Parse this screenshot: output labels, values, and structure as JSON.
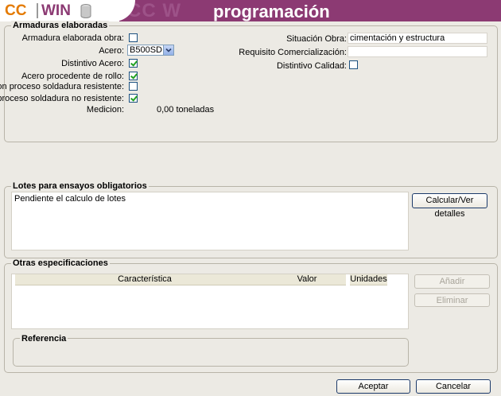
{
  "header": {
    "logo_cc": "CC",
    "logo_win": "WIN",
    "ghost_text": "CC W",
    "title": "programación"
  },
  "armaduras": {
    "title": "Armaduras elaboradas",
    "fields": {
      "armadura_elaborada_obra": {
        "label": "Armadura elaborada obra:",
        "checked": false
      },
      "acero": {
        "label": "Acero:",
        "value": "B500SD"
      },
      "distintivo_acero": {
        "label": "Distintivo Acero:",
        "checked": true
      },
      "acero_rollo": {
        "label": "Acero procedente de rollo:",
        "checked": true
      },
      "soldadura_resistente": {
        "label": "Con proceso soldadura resistente:",
        "checked": false
      },
      "soldadura_no_resistente": {
        "label": "Con proceso soldadura no resistente:",
        "checked": true
      },
      "medicion": {
        "label": "Medicion:",
        "value": "0,00 toneladas"
      },
      "situacion_obra": {
        "label": "Situación Obra:",
        "value": "cimentación y estructura"
      },
      "requisito_comercializacion": {
        "label": "Requisito Comercialización:",
        "value": ""
      },
      "distintivo_calidad": {
        "label": "Distintivo Calidad:",
        "checked": false
      }
    }
  },
  "lotes": {
    "title": "Lotes para ensayos obligatorios",
    "text": "Pendiente el calculo de lotes",
    "button": "Calcular/Ver detalles"
  },
  "otras": {
    "title": "Otras especificaciones",
    "columns": [
      "Característica",
      "Valor",
      "Unidades"
    ],
    "rows": [],
    "add_button": "Añadir",
    "delete_button": "Eliminar",
    "referencia_title": "Referencia"
  },
  "footer": {
    "accept": "Aceptar",
    "cancel": "Cancelar"
  },
  "colors": {
    "header_bg": "#8c3a73",
    "logo_orange": "#e47a00",
    "check_green": "#21a121"
  }
}
